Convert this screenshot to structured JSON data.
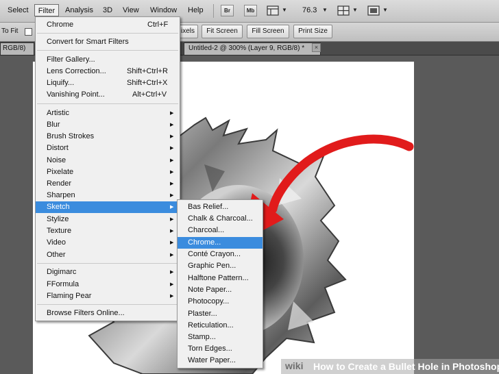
{
  "menubar": {
    "items": [
      "Select",
      "Filter",
      "Analysis",
      "3D",
      "View",
      "Window",
      "Help"
    ],
    "br_label": "Br",
    "mb_label": "Mb",
    "zoom": "76.3"
  },
  "options": {
    "to_fit": "To Fit",
    "pixels_fragment": "ixels",
    "fit_screen": "Fit Screen",
    "fill_screen": "Fill Screen",
    "print_size": "Print Size"
  },
  "tabs": {
    "partial": "RGB/8)",
    "active": "Untitled-2 @ 300% (Layer 9, RGB/8) *",
    "close": "×"
  },
  "filter_menu": {
    "top": [
      {
        "label": "Chrome",
        "shortcut": "Ctrl+F"
      },
      {
        "label": "Convert for Smart Filters"
      },
      {
        "label": "Filter Gallery..."
      },
      {
        "label": "Lens Correction...",
        "shortcut": "Shift+Ctrl+R"
      },
      {
        "label": "Liquify...",
        "shortcut": "Shift+Ctrl+X"
      },
      {
        "label": "Vanishing Point...",
        "shortcut": "Alt+Ctrl+V"
      }
    ],
    "groups": [
      "Artistic",
      "Blur",
      "Brush Strokes",
      "Distort",
      "Noise",
      "Pixelate",
      "Render",
      "Sharpen",
      "Sketch",
      "Stylize",
      "Texture",
      "Video",
      "Other"
    ],
    "plugins": [
      "Digimarc",
      "FFormula",
      "Flaming Pear"
    ],
    "browse": "Browse Filters Online...",
    "highlighted": "Sketch"
  },
  "sketch_submenu": {
    "items": [
      "Bas Relief...",
      "Chalk & Charcoal...",
      "Charcoal...",
      "Chrome...",
      "Conté Crayon...",
      "Graphic Pen...",
      "Halftone Pattern...",
      "Note Paper...",
      "Photocopy...",
      "Plaster...",
      "Reticulation...",
      "Stamp...",
      "Torn Edges...",
      "Water Paper..."
    ],
    "highlighted": "Chrome..."
  },
  "banner": {
    "brand": "wiki",
    "title": "How to Create a Bullet Hole in Photoshop"
  },
  "colors": {
    "highlight": "#3b8cde",
    "arrow": "#e11b1b",
    "menu_bg": "#f0f0f0"
  }
}
